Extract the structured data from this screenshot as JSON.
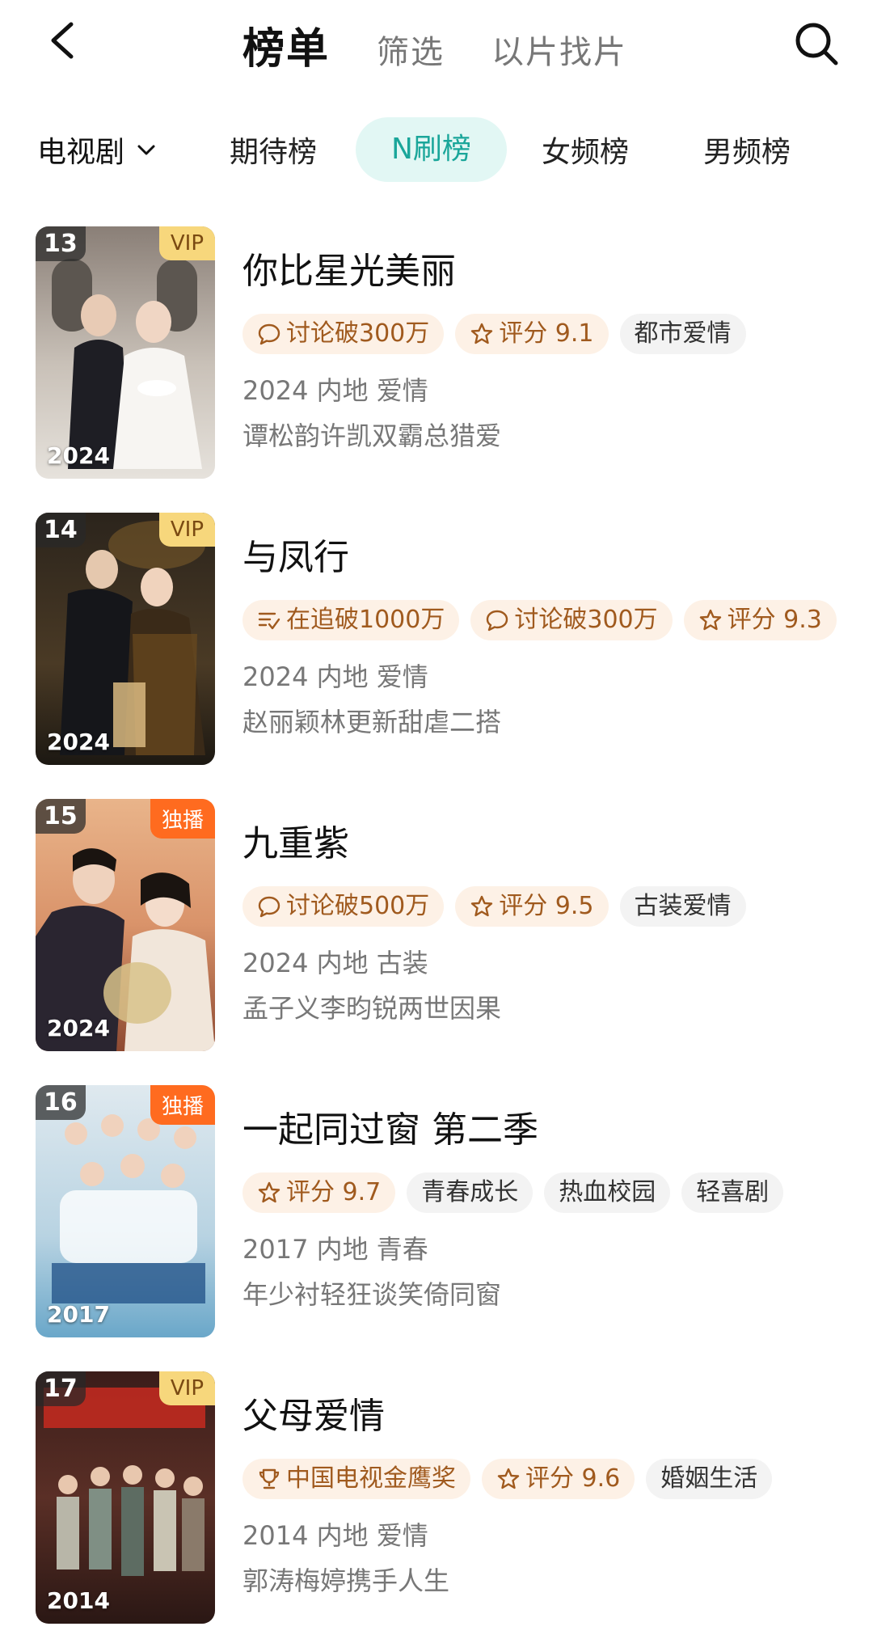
{
  "header": {
    "tabs": [
      {
        "label": "榜单",
        "active": true
      },
      {
        "label": "筛选",
        "active": false
      },
      {
        "label": "以片找片",
        "active": false
      }
    ]
  },
  "subnav": {
    "category": "电视剧",
    "tabs": [
      {
        "label": "期待榜",
        "active": false
      },
      {
        "label": "N刷榜",
        "active": true
      },
      {
        "label": "女频榜",
        "active": false
      },
      {
        "label": "男频榜",
        "active": false
      }
    ]
  },
  "colors": {
    "accent": "#1aa69a",
    "tag_highlight": "#a05a1e",
    "vip_badge": "#f7d77c",
    "exclusive_badge": "#ff6b1f"
  },
  "items": [
    {
      "rank": "13",
      "badge": "VIP",
      "badge_type": "vip",
      "poster_year": "2024",
      "title": "你比星光美丽",
      "tags": [
        {
          "text": "讨论破300万",
          "icon": "chat-bubble-icon",
          "style": "highlight"
        },
        {
          "text": "评分 9.1",
          "icon": "star-icon",
          "style": "highlight"
        },
        {
          "text": "都市爱情",
          "icon": "",
          "style": "plain"
        }
      ],
      "meta": "2024 内地 爱情",
      "desc": "谭松韵许凯双霸总猎爱"
    },
    {
      "rank": "14",
      "badge": "VIP",
      "badge_type": "vip",
      "poster_year": "2024",
      "title": "与凤行",
      "tags": [
        {
          "text": "在追破1000万",
          "icon": "list-check-icon",
          "style": "highlight"
        },
        {
          "text": "讨论破300万",
          "icon": "chat-bubble-icon",
          "style": "highlight"
        },
        {
          "text": "评分 9.3",
          "icon": "star-icon",
          "style": "highlight"
        }
      ],
      "meta": "2024 内地 爱情",
      "desc": "赵丽颖林更新甜虐二搭"
    },
    {
      "rank": "15",
      "badge": "独播",
      "badge_type": "excl",
      "poster_year": "2024",
      "title": "九重紫",
      "tags": [
        {
          "text": "讨论破500万",
          "icon": "chat-bubble-icon",
          "style": "highlight"
        },
        {
          "text": "评分 9.5",
          "icon": "star-icon",
          "style": "highlight"
        },
        {
          "text": "古装爱情",
          "icon": "",
          "style": "plain"
        }
      ],
      "meta": "2024 内地 古装",
      "desc": "孟子义李昀锐两世因果"
    },
    {
      "rank": "16",
      "badge": "独播",
      "badge_type": "excl",
      "poster_year": "2017",
      "title": "一起同过窗 第二季",
      "tags": [
        {
          "text": "评分 9.7",
          "icon": "star-icon",
          "style": "highlight"
        },
        {
          "text": "青春成长",
          "icon": "",
          "style": "plain"
        },
        {
          "text": "热血校园",
          "icon": "",
          "style": "plain"
        },
        {
          "text": "轻喜剧",
          "icon": "",
          "style": "plain"
        }
      ],
      "meta": "2017 内地 青春",
      "desc": "年少衬轻狂谈笑倚同窗"
    },
    {
      "rank": "17",
      "badge": "VIP",
      "badge_type": "vip",
      "poster_year": "2014",
      "title": "父母爱情",
      "tags": [
        {
          "text": "中国电视金鹰奖",
          "icon": "trophy-icon",
          "style": "highlight"
        },
        {
          "text": "评分 9.6",
          "icon": "star-icon",
          "style": "highlight"
        },
        {
          "text": "婚姻生活",
          "icon": "",
          "style": "plain"
        }
      ],
      "meta": "2014 内地 爱情",
      "desc": "郭涛梅婷携手人生"
    }
  ]
}
